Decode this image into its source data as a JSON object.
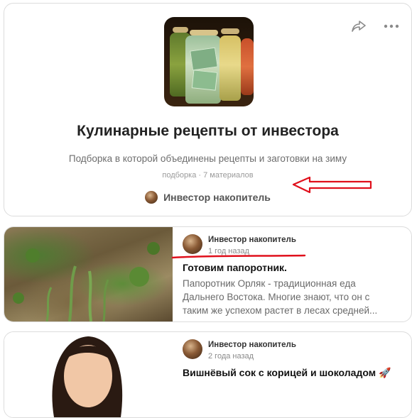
{
  "collection": {
    "title": "Кулинарные рецепты от инвестора",
    "description": "Подборка в которой объединены рецепты и заготовки на зиму",
    "meta": "подборка · 7 материалов",
    "author": "Инвестор накопитель",
    "share_icon": "share-icon",
    "more_icon": "more-dots-icon"
  },
  "posts": [
    {
      "author": "Инвестор накопитель",
      "time": "1 год назад",
      "title": "Готовим папоротник.",
      "snippet": "Папоротник Орляк - традиционная еда Дальнего Востока. Многие знают, что он с таким же успехом растет в лесах средней..."
    },
    {
      "author": "Инвестор накопитель",
      "time": "2 года назад",
      "title": "Вишнёвый сок с корицей и шоколадом 🚀"
    }
  ],
  "annotations": {
    "arrow_color": "#e0101c",
    "underline_color": "#e0101c"
  }
}
